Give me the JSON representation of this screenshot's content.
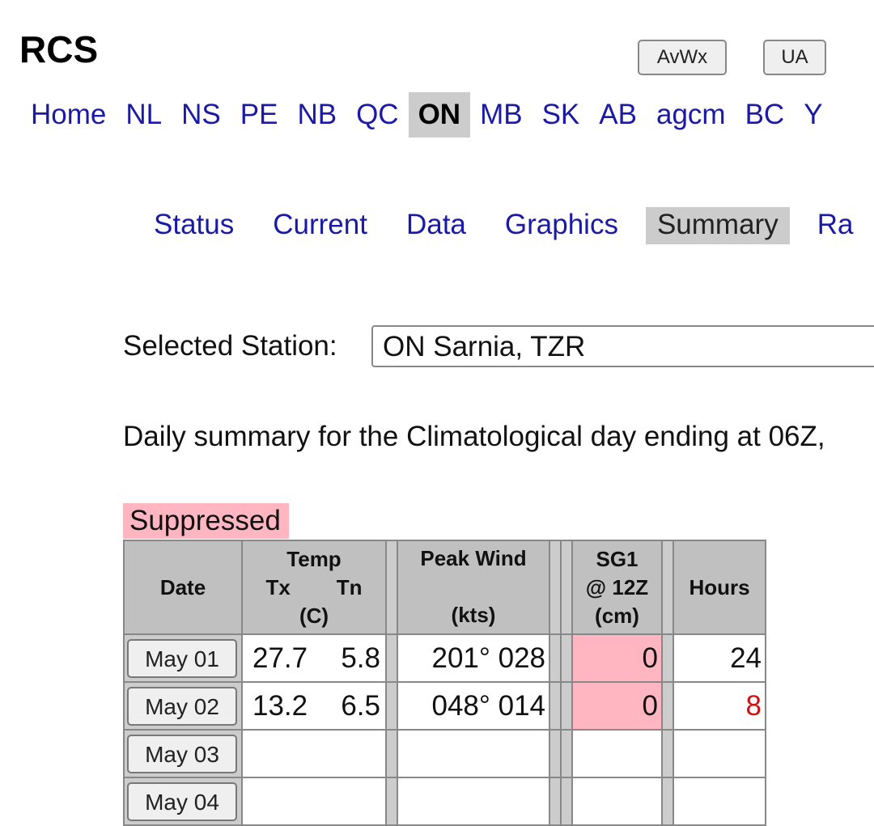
{
  "header": {
    "title": "RCS",
    "buttons": [
      "AvWx",
      "UA"
    ]
  },
  "nav": {
    "items": [
      "Home",
      "NL",
      "NS",
      "PE",
      "NB",
      "QC",
      "ON",
      "MB",
      "SK",
      "AB",
      "agcm",
      "BC",
      "Y"
    ],
    "active": "ON"
  },
  "subnav": {
    "items": [
      "Status",
      "Current",
      "Data",
      "Graphics",
      "Summary",
      "Ra"
    ],
    "active": "Summary"
  },
  "station": {
    "label": "Selected Station:",
    "value": "ON Sarnia, TZR"
  },
  "description": "Daily summary for the Climatological day ending at 06Z,",
  "badge": "Suppressed",
  "colors": {
    "link": "#1a1aa6",
    "highlight": "#ffb6c1",
    "alert": "#cc1111",
    "header_bg": "#c0c0c0"
  },
  "table": {
    "headers": {
      "date": "Date",
      "temp": "Temp",
      "tx": "Tx",
      "tn": "Tn",
      "temp_unit": "(C)",
      "wind": "Peak Wind",
      "wind_unit": "(kts)",
      "sg1": "SG1",
      "sg1_time": "@ 12Z",
      "sg1_unit": "(cm)",
      "hours": "Hours"
    },
    "rows": [
      {
        "date": "May 01",
        "tx": "27.7",
        "tn": "5.8",
        "wind": "201° 028",
        "sg1": "0",
        "hours": "24"
      },
      {
        "date": "May 02",
        "tx": "13.2",
        "tn": "6.5",
        "wind": "048° 014",
        "sg1": "0",
        "hours": "8"
      },
      {
        "date": "May 03",
        "tx": "",
        "tn": "",
        "wind": "",
        "sg1": "",
        "hours": ""
      },
      {
        "date": "May 04",
        "tx": "",
        "tn": "",
        "wind": "",
        "sg1": "",
        "hours": ""
      }
    ]
  }
}
